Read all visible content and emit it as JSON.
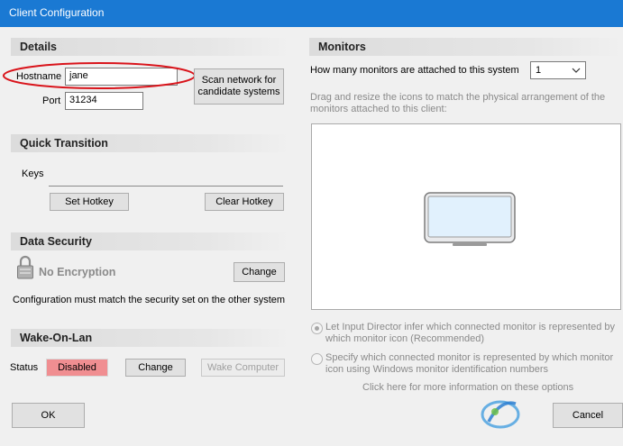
{
  "window": {
    "title": "Client Configuration"
  },
  "details": {
    "header": "Details",
    "hostname_label": "Hostname",
    "hostname_value": "jane",
    "port_label": "Port",
    "port_value": "31234",
    "scan_button": "Scan network for candidate systems"
  },
  "quick_transition": {
    "header": "Quick Transition",
    "keys_label": "Keys",
    "set_hotkey": "Set Hotkey",
    "clear_hotkey": "Clear Hotkey"
  },
  "data_security": {
    "header": "Data Security",
    "encryption_status": "No Encryption",
    "change_button": "Change",
    "note": "Configuration must match the security set on the other system"
  },
  "wake_on_lan": {
    "header": "Wake-On-Lan",
    "status_label": "Status",
    "status_value": "Disabled",
    "change_button": "Change",
    "wake_button": "Wake Computer"
  },
  "monitors": {
    "header": "Monitors",
    "count_question": "How many monitors are attached to this system",
    "count_value": "1",
    "instructions": "Drag and resize the icons to match the physical arrangement of the monitors attached to this client:",
    "option_infer": "Let Input Director infer which connected monitor is represented by which monitor icon (Recommended)",
    "option_specify": "Specify which connected monitor is represented by which monitor icon using Windows monitor identification numbers",
    "more_info": "Click here for more information on these options"
  },
  "footer": {
    "ok": "OK",
    "cancel": "Cancel"
  },
  "colors": {
    "titlebar": "#1a79d3",
    "status_disabled": "#f08e91",
    "highlight_ellipse": "#d9141b"
  },
  "icons": [
    "lock-icon",
    "chevron-down-icon",
    "monitor-icon",
    "watermark-logo-icon"
  ]
}
